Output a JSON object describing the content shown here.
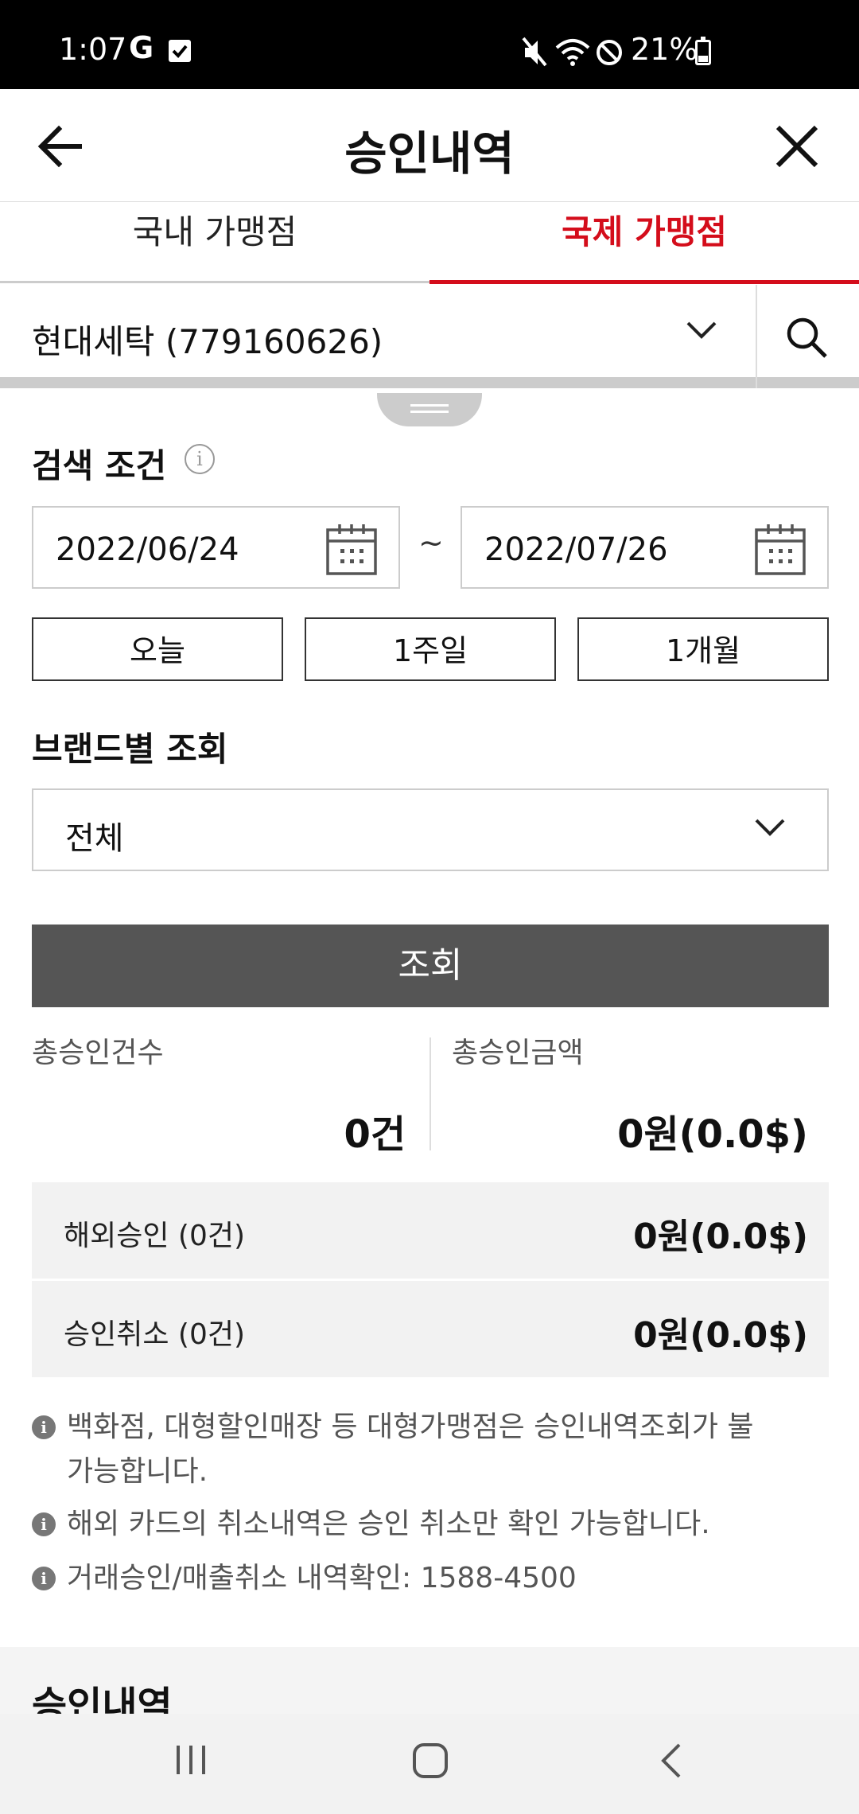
{
  "status_bar": {
    "time": "1:07",
    "google_glyph": "G",
    "battery": "21%",
    "icons": [
      "g-icon",
      "checkbox-icon",
      "mute-icon",
      "wifi-icon",
      "do-not-disturb-icon",
      "battery-icon"
    ]
  },
  "header": {
    "title": "승인내역"
  },
  "tabs": [
    {
      "label": "국내 가맹점",
      "active": false
    },
    {
      "label": "국제 가맹점",
      "active": true
    }
  ],
  "merchant": {
    "selected": "현대세탁 (779160626)"
  },
  "search_conditions": {
    "title": "검색 조건",
    "info_glyph": "i",
    "start_date": "2022/06/24",
    "separator": "~",
    "end_date": "2022/07/26",
    "range_buttons": [
      "오늘",
      "1주일",
      "1개월"
    ]
  },
  "brand": {
    "title": "브랜드별 조회",
    "selected": "전체"
  },
  "query_button": "조회",
  "totals": {
    "count_label": "총승인건수",
    "count_value": "0건",
    "amount_label": "총승인금액",
    "amount_value": "0원(0.0$)"
  },
  "summary_rows": [
    {
      "label": "해외승인 (0건)",
      "amount": "0원(0.0$)"
    },
    {
      "label": "승인취소 (0건)",
      "amount": "0원(0.0$)"
    }
  ],
  "notes": [
    "백화점, 대형할인매장 등 대형가맹점은 승인내역조회가 불가능합니다.",
    "해외 카드의 취소내역은 승인 취소만 확인 가능합니다.",
    "거래승인/매출취소 내역확인: 1588-4500"
  ],
  "note_glyph": "i",
  "history_title": "승인내역",
  "colors": {
    "accent_red": "#d40d1b",
    "button_gray": "#555555",
    "row_bg": "#f2f2f2"
  }
}
